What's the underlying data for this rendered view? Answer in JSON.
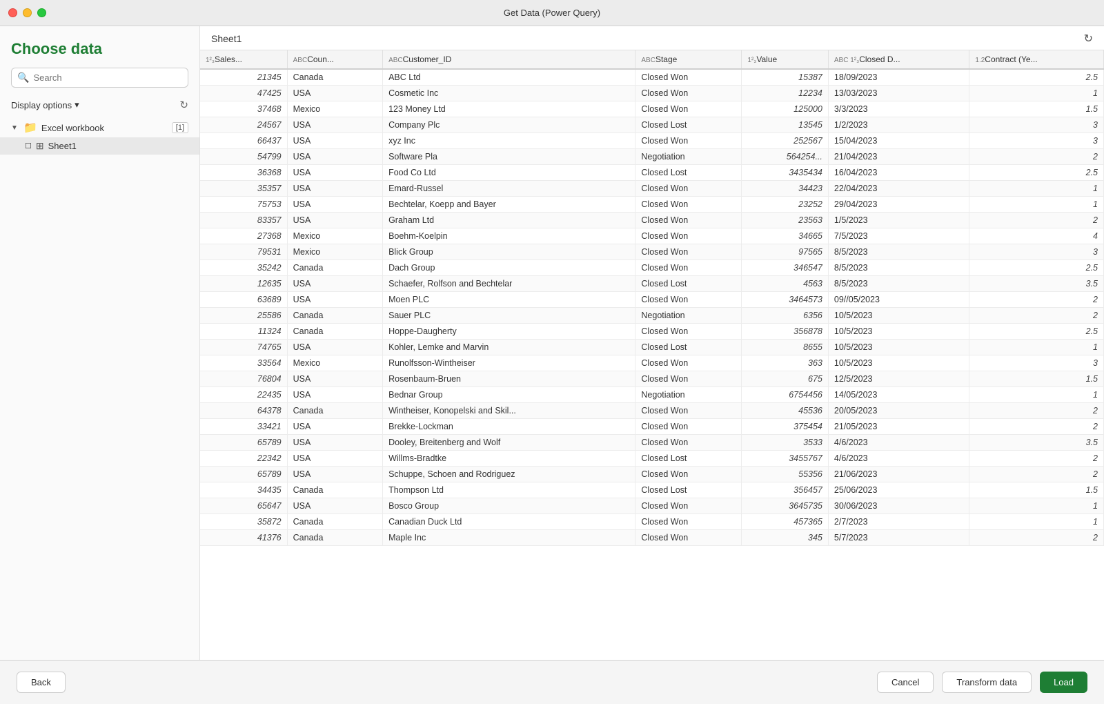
{
  "window": {
    "title": "Get Data (Power Query)"
  },
  "sidebar": {
    "choose_data_label": "Choose data",
    "search_placeholder": "Search",
    "display_options_label": "Display options",
    "tree": {
      "workbook_label": "Excel workbook",
      "workbook_badge": "[1]",
      "sheet_label": "Sheet1"
    }
  },
  "content": {
    "sheet_name": "Sheet1",
    "columns": [
      {
        "type": "1²₃",
        "name": "Sales..."
      },
      {
        "type": "ABC",
        "name": "Coun..."
      },
      {
        "type": "ABC",
        "name": "Customer_ID"
      },
      {
        "type": "ABC",
        "name": "Stage"
      },
      {
        "type": "1²₃",
        "name": "Value"
      },
      {
        "type": "ABC 1²₃",
        "name": "Closed D..."
      },
      {
        "type": "1.2",
        "name": "Contract (Ye..."
      }
    ],
    "rows": [
      [
        "21345",
        "Canada",
        "ABC Ltd",
        "Closed Won",
        "15387",
        "18/09/2023",
        "2.5"
      ],
      [
        "47425",
        "USA",
        "Cosmetic Inc",
        "Closed Won",
        "12234",
        "13/03/2023",
        "1"
      ],
      [
        "37468",
        "Mexico",
        "123 Money Ltd",
        "Closed Won",
        "125000",
        "3/3/2023",
        "1.5"
      ],
      [
        "24567",
        "USA",
        "Company Plc",
        "Closed Lost",
        "13545",
        "1/2/2023",
        "3"
      ],
      [
        "66437",
        "USA",
        "xyz Inc",
        "Closed Won",
        "252567",
        "15/04/2023",
        "3"
      ],
      [
        "54799",
        "USA",
        "Software Pla",
        "Negotiation",
        "564254...",
        "21/04/2023",
        "2"
      ],
      [
        "36368",
        "USA",
        "Food Co Ltd",
        "Closed Lost",
        "3435434",
        "16/04/2023",
        "2.5"
      ],
      [
        "35357",
        "USA",
        "Emard-Russel",
        "Closed Won",
        "34423",
        "22/04/2023",
        "1"
      ],
      [
        "75753",
        "USA",
        "Bechtelar, Koepp and Bayer",
        "Closed Won",
        "23252",
        "29/04/2023",
        "1"
      ],
      [
        "83357",
        "USA",
        "Graham Ltd",
        "Closed Won",
        "23563",
        "1/5/2023",
        "2"
      ],
      [
        "27368",
        "Mexico",
        "Boehm-Koelpin",
        "Closed Won",
        "34665",
        "7/5/2023",
        "4"
      ],
      [
        "79531",
        "Mexico",
        "Blick Group",
        "Closed Won",
        "97565",
        "8/5/2023",
        "3"
      ],
      [
        "35242",
        "Canada",
        "Dach Group",
        "Closed Won",
        "346547",
        "8/5/2023",
        "2.5"
      ],
      [
        "12635",
        "USA",
        "Schaefer, Rolfson and Bechtelar",
        "Closed Lost",
        "4563",
        "8/5/2023",
        "3.5"
      ],
      [
        "63689",
        "USA",
        "Moen PLC",
        "Closed Won",
        "3464573",
        "09//05/2023",
        "2"
      ],
      [
        "25586",
        "Canada",
        "Sauer PLC",
        "Negotiation",
        "6356",
        "10/5/2023",
        "2"
      ],
      [
        "11324",
        "Canada",
        "Hoppe-Daugherty",
        "Closed Won",
        "356878",
        "10/5/2023",
        "2.5"
      ],
      [
        "74765",
        "USA",
        "Kohler, Lemke and Marvin",
        "Closed Lost",
        "8655",
        "10/5/2023",
        "1"
      ],
      [
        "33564",
        "Mexico",
        "Runolfsson-Wintheiser",
        "Closed Won",
        "363",
        "10/5/2023",
        "3"
      ],
      [
        "76804",
        "USA",
        "Rosenbaum-Bruen",
        "Closed Won",
        "675",
        "12/5/2023",
        "1.5"
      ],
      [
        "22435",
        "USA",
        "Bednar Group",
        "Negotiation",
        "6754456",
        "14/05/2023",
        "1"
      ],
      [
        "64378",
        "Canada",
        "Wintheiser, Konopelski and Skil...",
        "Closed Won",
        "45536",
        "20/05/2023",
        "2"
      ],
      [
        "33421",
        "USA",
        "Brekke-Lockman",
        "Closed Won",
        "375454",
        "21/05/2023",
        "2"
      ],
      [
        "65789",
        "USA",
        "Dooley, Breitenberg and Wolf",
        "Closed Won",
        "3533",
        "4/6/2023",
        "3.5"
      ],
      [
        "22342",
        "USA",
        "Willms-Bradtke",
        "Closed Lost",
        "3455767",
        "4/6/2023",
        "2"
      ],
      [
        "65789",
        "USA",
        "Schuppe, Schoen and Rodriguez",
        "Closed Won",
        "55356",
        "21/06/2023",
        "2"
      ],
      [
        "34435",
        "Canada",
        "Thompson Ltd",
        "Closed Lost",
        "356457",
        "25/06/2023",
        "1.5"
      ],
      [
        "65647",
        "USA",
        "Bosco Group",
        "Closed Won",
        "3645735",
        "30/06/2023",
        "1"
      ],
      [
        "35872",
        "Canada",
        "Canadian Duck Ltd",
        "Closed Won",
        "457365",
        "2/7/2023",
        "1"
      ],
      [
        "41376",
        "Canada",
        "Maple Inc",
        "Closed Won",
        "345",
        "5/7/2023",
        "2"
      ]
    ]
  },
  "footer": {
    "back_label": "Back",
    "cancel_label": "Cancel",
    "transform_data_label": "Transform data",
    "load_label": "Load"
  }
}
